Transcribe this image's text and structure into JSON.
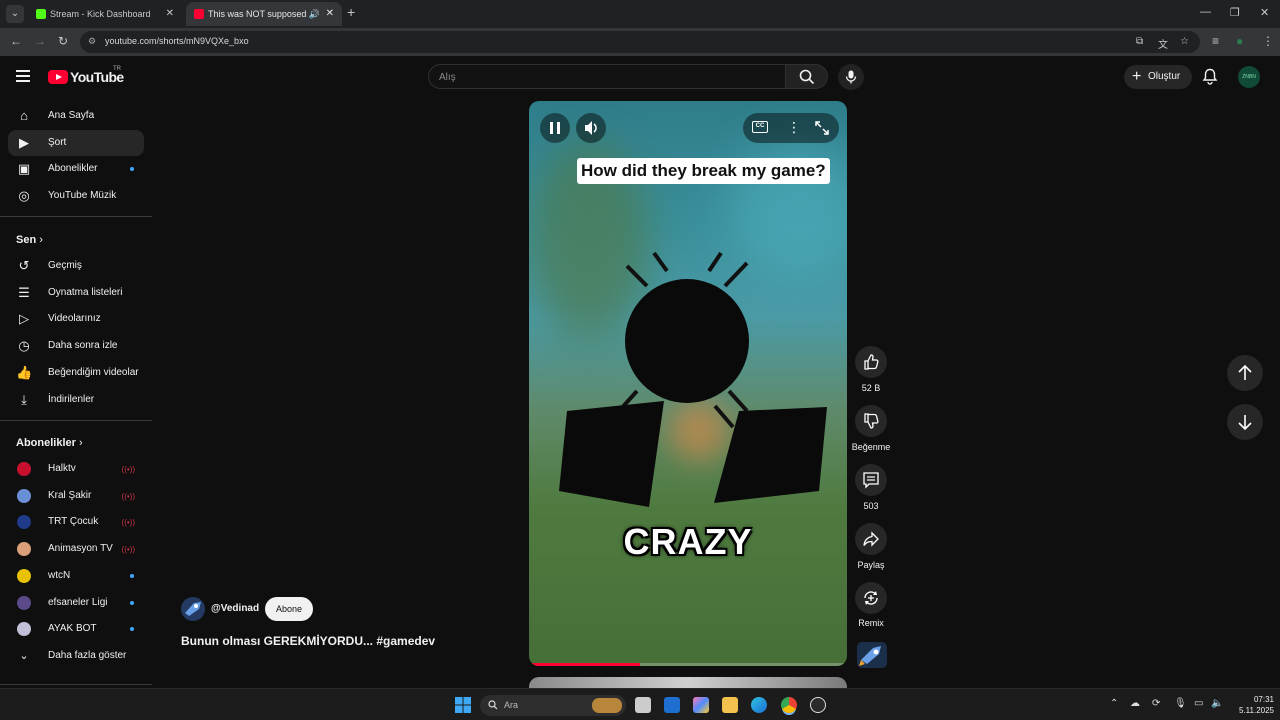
{
  "browser": {
    "tabs": [
      {
        "title": "Stream - Kick Dashboard",
        "favicon_color": "#53fc18",
        "active": false
      },
      {
        "title": "This was NOT supposed to h",
        "favicon_color": "#ff0033",
        "active": true
      }
    ],
    "new_tab": "+",
    "url": "youtube.com/shorts/mN9VQXe_bxo"
  },
  "youtube": {
    "logo_text": "YouTube",
    "country_code": "TR",
    "search_placeholder": "Alış",
    "create_label": "Oluştur",
    "avatar_text": "ZNBN",
    "sidebar": {
      "main": [
        {
          "label": "Ana Sayfa",
          "icon": "home-icon"
        },
        {
          "label": "Şort",
          "icon": "shorts-icon",
          "active": true
        },
        {
          "label": "Abonelikler",
          "icon": "subscriptions-icon",
          "dot": true
        },
        {
          "label": "YouTube Müzik",
          "icon": "music-icon"
        }
      ],
      "you_title": "Sen",
      "you": [
        {
          "label": "Geçmiş",
          "icon": "history-icon"
        },
        {
          "label": "Oynatma listeleri",
          "icon": "playlists-icon"
        },
        {
          "label": "Videolarınız",
          "icon": "your-videos-icon"
        },
        {
          "label": "Daha sonra izle",
          "icon": "watch-later-icon"
        },
        {
          "label": "Beğendiğim videolar",
          "icon": "liked-icon"
        },
        {
          "label": "İndirilenler",
          "icon": "downloads-icon"
        }
      ],
      "subs_title": "Abonelikler",
      "subscriptions": [
        {
          "label": "Halktv",
          "color": "#c8102e",
          "status": "live"
        },
        {
          "label": "Kral Şakir",
          "color": "#6b8fd6",
          "status": "live"
        },
        {
          "label": "TRT Çocuk",
          "color": "#1f3b8a",
          "status": "live"
        },
        {
          "label": "Animasyon TV",
          "color": "#d9a07a",
          "status": "live"
        },
        {
          "label": "wtcN",
          "color": "#e8c100",
          "status": "new"
        },
        {
          "label": "efsaneler Ligi",
          "color": "#5a4a8a",
          "status": "new"
        },
        {
          "label": "AYAK BOT",
          "color": "#c0c0d8",
          "status": "new"
        }
      ],
      "show_more": "Daha fazla göster"
    },
    "short": {
      "caption": "How did they break my game?",
      "overlay_word": "CRAZY",
      "progress_fraction": 0.35,
      "channel": "@Vedinad",
      "subscribe_label": "Abone",
      "title": "Bunun olması GEREKMİYORDU... #gamedev",
      "actions": {
        "likes": "52 B",
        "dislike": "Beğenme",
        "comments": "503",
        "share": "Paylaş",
        "remix": "Remix"
      }
    }
  },
  "taskbar": {
    "search_label": "Ara",
    "time": "07:31",
    "date": "5.11.2025"
  }
}
